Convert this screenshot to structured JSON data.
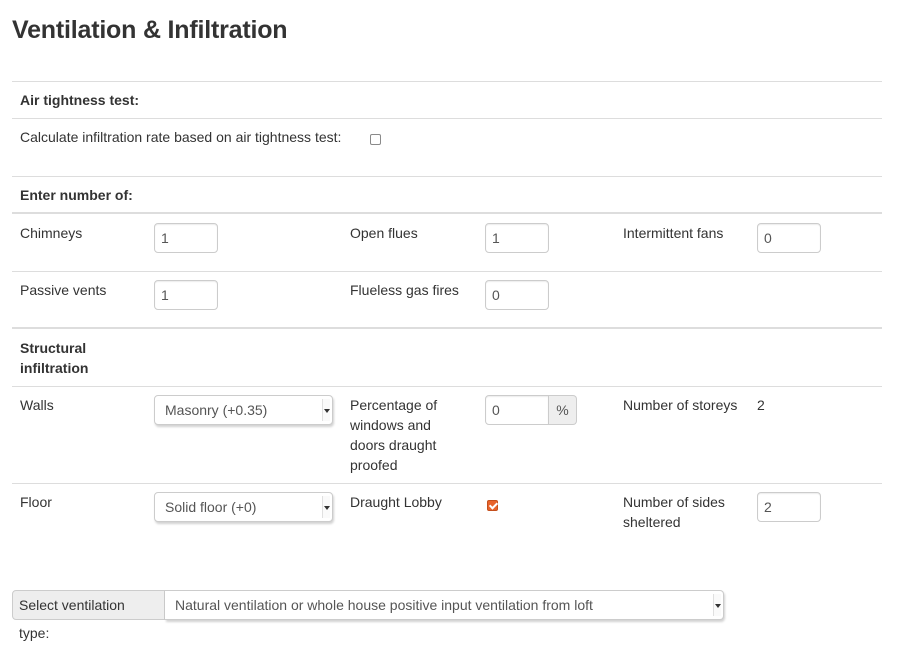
{
  "page_title": "Ventilation & Infiltration",
  "air_tightness": {
    "heading": "Air tightness test:",
    "calc_label": "Calculate infiltration rate based on air tightness test:",
    "calc_checked": false
  },
  "counts": {
    "heading": "Enter number of:",
    "chimneys_label": "Chimneys",
    "chimneys_value": "1",
    "open_flues_label": "Open flues",
    "open_flues_value": "1",
    "intermittent_fans_label": "Intermittent fans",
    "intermittent_fans_value": "0",
    "passive_vents_label": "Passive vents",
    "passive_vents_value": "1",
    "flueless_gas_fires_label": "Flueless gas fires",
    "flueless_gas_fires_value": "0"
  },
  "structural": {
    "heading_line1": "Structural",
    "heading_line2": "infiltration",
    "walls_label": "Walls",
    "walls_selected": "Masonry (+0.35)",
    "draught_pct_label_lines": [
      "Percentage of",
      "windows and",
      "doors draught",
      "proofed"
    ],
    "draught_pct_value": "0",
    "draught_pct_unit": "%",
    "storeys_label": "Number of storeys",
    "storeys_value": "2",
    "floor_label": "Floor",
    "floor_selected": "Solid floor (+0)",
    "draught_lobby_label": "Draught Lobby",
    "draught_lobby_checked": true,
    "sides_sheltered_label_lines": [
      "Number of sides",
      "sheltered"
    ],
    "sides_sheltered_value": "2"
  },
  "ventilation": {
    "label": "Select ventilation type:",
    "selected": "Natural ventilation or whole house positive input ventilation from loft"
  },
  "colors": {
    "checkbox_checked": "#e8632b",
    "border": "#dddddd",
    "text": "#333333"
  }
}
